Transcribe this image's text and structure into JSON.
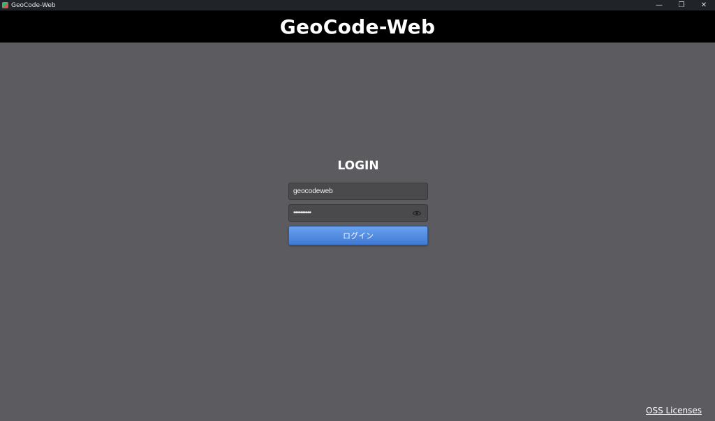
{
  "window": {
    "title": "GeoCode-Web",
    "minimize_icon": "—",
    "restore_icon": "❐",
    "close_icon": "✕"
  },
  "header": {
    "title": "GeoCode-Web"
  },
  "login": {
    "heading": "LOGIN",
    "username_value": "geocodeweb",
    "password_value": "••••••••••",
    "submit_label": "ログイン"
  },
  "footer": {
    "oss_link": "OSS Licenses"
  },
  "colors": {
    "background": "#5b5b60",
    "header": "#000000",
    "button": "#4f8ae2"
  }
}
